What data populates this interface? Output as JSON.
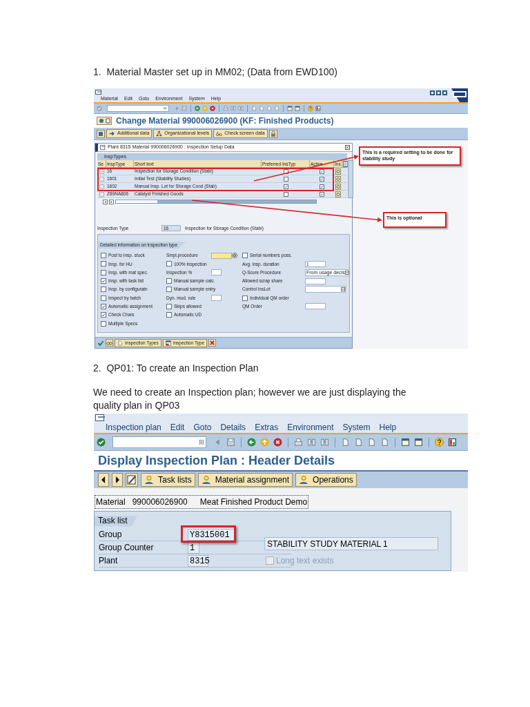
{
  "step_1": {
    "heading": "1.  Material Master set up in MM02; (Data from EWD100)"
  },
  "screen_1": {
    "menu": [
      "Material",
      "Edit",
      "Goto",
      "Environment",
      "System",
      "Help"
    ],
    "title": "Change Material 990006026900 (KF: Finished Products)",
    "app_buttons": [
      "Additional data",
      "Organizational levels",
      "Check screen data"
    ],
    "dialog": {
      "title": "Plant 8315 Material 990006026900 : Inspection Setup Data",
      "table_title": "InspTypes",
      "columns": [
        "Se",
        "InspType",
        "Short text",
        "Preferred InsTyp",
        "Active",
        "Ins"
      ],
      "rows": [
        {
          "selected": true,
          "insp_type": "16",
          "short_text": "Inspection for Storage Condition (Stabi)",
          "preferred": false,
          "active": true
        },
        {
          "selected": false,
          "insp_type": "1601",
          "short_text": "Initial Test (Stability Studies)",
          "preferred": false,
          "active": true
        },
        {
          "selected": false,
          "insp_type": "1602",
          "short_text": "Manual Insp. Lot for Storage Cond (Stab)",
          "preferred": true,
          "active": true
        },
        {
          "selected": false,
          "insp_type": "Z89NA806",
          "short_text": "Catalyst Finished Goods",
          "preferred": false,
          "active": true
        }
      ],
      "inspection_type": {
        "label": "Inspection Type",
        "value": "16",
        "description": "Inspection for Storage Condition (Stabi)"
      },
      "details_title": "Detailed information on inspection type",
      "details_columns": [
        [
          {
            "kind": "checkbox",
            "label": "Post to insp. stock",
            "checked": false
          },
          {
            "kind": "checkbox",
            "label": "Insp. for HU",
            "checked": false
          },
          {
            "kind": "checkbox",
            "label": "Insp. with mat spec.",
            "checked": false
          },
          {
            "kind": "checkbox",
            "label": "Insp. with task list",
            "checked": true
          },
          {
            "kind": "checkbox",
            "label": "Insp. by configuratn",
            "checked": false
          },
          {
            "kind": "checkbox",
            "label": "Inspect by batch",
            "checked": false
          },
          {
            "kind": "checkbox",
            "label": "Automatic assignment",
            "checked": true
          },
          {
            "kind": "checkbox",
            "label": "Check Chars",
            "checked": true
          },
          {
            "kind": "checkbox",
            "label": "Multiple Specs",
            "checked": false
          }
        ],
        [
          {
            "kind": "field",
            "label": "Smpl.procedure",
            "required": true
          },
          {
            "kind": "checkbox",
            "label": "100% inspection",
            "checked": false
          },
          {
            "kind": "field",
            "label": "Inspection %",
            "required": false
          },
          {
            "kind": "checkbox",
            "label": "Manual sample calc.",
            "checked": false
          },
          {
            "kind": "checkbox",
            "label": "Manual sample entry",
            "checked": false
          },
          {
            "kind": "field",
            "label": "Dyn. mod. rule",
            "required": false
          },
          {
            "kind": "checkbox",
            "label": "Skips allowed",
            "checked": false
          },
          {
            "kind": "checkbox",
            "label": "Automatic UD",
            "checked": false
          }
        ],
        [
          {
            "kind": "checkbox",
            "label": "Serial numbers poss.",
            "checked": false
          },
          {
            "kind": "field",
            "label": "Avg. insp. duration",
            "value": "1",
            "required": false
          },
          {
            "kind": "dropdown",
            "label": "Q-Score Procedure",
            "value": "From usage decis"
          },
          {
            "kind": "field",
            "label": "Allowed scrap share",
            "required": false
          },
          {
            "kind": "dropdown",
            "label": "Control InsLot"
          },
          {
            "kind": "checkbox",
            "label": "Individual QM order",
            "checked": false
          },
          {
            "kind": "field",
            "label": "QM Order",
            "required": false
          }
        ]
      ],
      "footer_buttons": [
        "Inspection Types",
        "Inspection Type"
      ]
    },
    "callouts": [
      "This is a required setting to be done for stability study",
      "This is optional"
    ]
  },
  "step_2": {
    "heading": "2.  QP01: To create an Inspection Plan",
    "paragraph": "We need to create an Inspection plan; however we are just displaying the quality plan in QP03"
  },
  "screen_2": {
    "menu": [
      "Inspection plan",
      "Edit",
      "Goto",
      "Details",
      "Extras",
      "Environment",
      "System",
      "Help"
    ],
    "title": "Display Inspection Plan : Header Details",
    "app_buttons": [
      "Task lists",
      "Material assignment",
      "Operations"
    ],
    "material": {
      "label": "Material",
      "number": "990006026900",
      "description": "Meat Finished Product Demo"
    },
    "task_list": {
      "title": "Task list",
      "group_label": "Group",
      "group": "Y8315001",
      "counter_label": "Group Counter",
      "counter": "1",
      "description": "STABILITY STUDY MATERIAL 1",
      "plant_label": "Plant",
      "plant": "8315",
      "long_text": {
        "label": "Long text exists",
        "checked": false,
        "disabled": true
      }
    }
  }
}
